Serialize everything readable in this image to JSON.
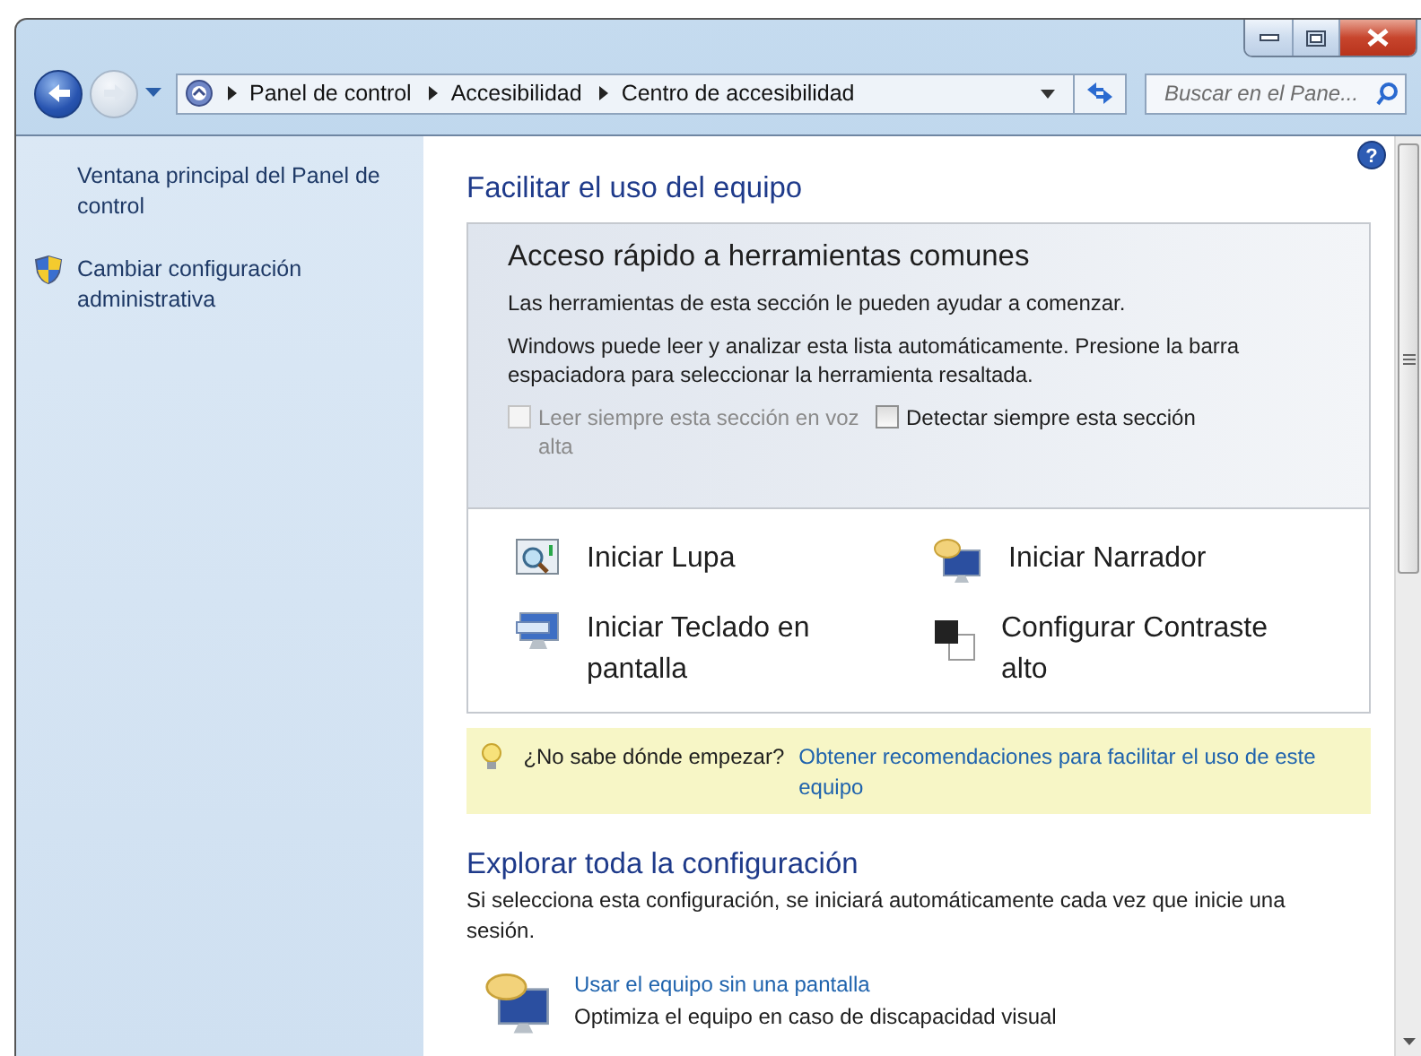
{
  "window": {
    "caption_buttons": [
      {
        "kind": "minimize"
      },
      {
        "kind": "maximize"
      },
      {
        "kind": "close"
      }
    ]
  },
  "address_bar": {
    "breadcrumbs": [
      "Panel de control",
      "Accesibilidad",
      "Centro de accesibilidad"
    ]
  },
  "search": {
    "placeholder": "Buscar en el Pane..."
  },
  "help_button": "?",
  "sidebar": {
    "items": [
      {
        "text": "Ventana principal del Panel de control",
        "kind": "link"
      },
      {
        "text": "Cambiar configuración administrativa",
        "kind": "admin"
      }
    ]
  },
  "main": {
    "title": "Facilitar el uso del equipo",
    "quick_access": {
      "title": "Acceso rápido a herramientas comunes",
      "paragraphs": [
        "Las herramientas de esta sección le pueden ayudar a comenzar.",
        "Windows puede leer y analizar esta lista automáticamente. Presione la barra espaciadora para seleccionar la herramienta resaltada."
      ],
      "checkboxes": [
        {
          "label": "Leer siempre esta sección en voz alta",
          "checked": false,
          "disabled": true
        },
        {
          "label": "Detectar siempre esta sección",
          "checked": false,
          "disabled": false
        }
      ],
      "tools": [
        {
          "label": "Iniciar Lupa",
          "kind": "magnifier"
        },
        {
          "label": "Iniciar Narrador",
          "kind": "narrator"
        },
        {
          "label": "Iniciar Teclado en pantalla",
          "kind": "keyboard"
        },
        {
          "label": "Configurar Contraste alto",
          "kind": "contrast"
        }
      ]
    },
    "tip": {
      "question": "¿No sabe dónde empezar?",
      "link": "Obtener recomendaciones para facilitar el uso de este equipo"
    },
    "explore": {
      "title": "Explorar toda la configuración",
      "description": "Si selecciona esta configuración, se iniciará automáticamente cada vez que inicie una sesión.",
      "items": [
        {
          "title": "Usar el equipo sin una pantalla",
          "description": "Optimiza el equipo en caso de discapacidad visual"
        }
      ]
    }
  }
}
